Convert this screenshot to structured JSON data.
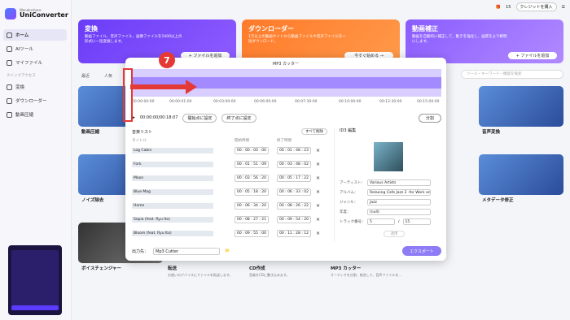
{
  "app": {
    "brand_small": "Wondershare",
    "brand_big": "UniConverter",
    "credits": "15",
    "buy_credits": "クレジットを購入"
  },
  "sidebar": {
    "items": [
      {
        "label": "ホーム"
      },
      {
        "label": "AIツール"
      },
      {
        "label": "マイファイル"
      },
      {
        "label": "変換"
      },
      {
        "label": "ダウンローダー"
      },
      {
        "label": "動画圧縮"
      }
    ],
    "section": "クイックアクセス"
  },
  "cards": [
    {
      "title": "変換",
      "desc": "動画ファイル、音声ファイル、画像ファイルを1000以上の形式に一括変換します。",
      "button": "+ ファイルを追加"
    },
    {
      "title": "ダウンローダー",
      "desc": "1万以上の動画サイトから動画ファイルや音声ファイルを一括ダウンロード。",
      "button": "今すぐ始める →"
    },
    {
      "title": "動画補正",
      "desc": "動画を自動的に補正して、動きを強化し、画質をより鮮明にします。",
      "button": "+ ファイルを追加"
    }
  ],
  "tiles": {
    "t1_label": "動画圧縮",
    "t2_label": "ノイズ除去",
    "t3_label": "ボイスチェンジャー",
    "t4_label": "音声変換",
    "t5_label": "メタデータ修正",
    "b1": "転送",
    "b2": "CD作成",
    "b3": "MP3 カッター",
    "d1": "お使いのデバイスにファイルを転送します。",
    "d2": "音楽をCDに書き込みます。",
    "d3": "オーディオを分割、結合して、音声ファイルを…"
  },
  "tabs": {
    "recent": "最近",
    "hot": "人気"
  },
  "search": {
    "placeholder": "ツール・キーワード・機能を検索"
  },
  "modal": {
    "title": "MP3 カッター",
    "timeline": [
      "00:00:00:00",
      "00:00:01:00",
      "00:03:00:00",
      "00:06:00:00",
      "00:07:30:00",
      "00:10:00:00",
      "00:12:30:00",
      "00:15:00:00"
    ],
    "time_display": "00:00:00/00:18:07",
    "btn_set_start": "開始点に設定",
    "btn_set_end": "終了点に設定",
    "btn_split": "分割",
    "list_title": "音楽リスト",
    "clear_all": "すべて削除",
    "col_title": "タイトル",
    "col_start": "開始時間",
    "col_end": "終了時間",
    "rows": [
      {
        "name": "Log Cabin",
        "start": "00 : 00 : 00 : 00",
        "end": "00 : 01 : 48 : 23"
      },
      {
        "name": "Fork",
        "start": "00 : 01 : 51 : 09",
        "end": "00 : 03 : 48 : 02"
      },
      {
        "name": "Moon",
        "start": "00 : 03 : 56 : 20",
        "end": "00 : 05 : 17 : 22"
      },
      {
        "name": "Blue Mag",
        "start": "00 : 05 : 18 : 20",
        "end": "00 : 06 : 33 : 02"
      },
      {
        "name": "Home",
        "start": "00 : 06 : 34 : 20",
        "end": "00 : 08 : 26 : 22"
      },
      {
        "name": "Sepia (feat. Ryu Ito)",
        "start": "00 : 08 : 27 : 21",
        "end": "00 : 09 : 54 : 20"
      },
      {
        "name": "Bloom (feat. Ryu Ito)",
        "start": "00 : 09 : 55 : 00",
        "end": "00 : 11 : 28 : 12"
      }
    ],
    "id3_title": "ID3 編集",
    "artist_label": "アーティスト：",
    "artist_value": "Various Artists",
    "album_label": "アルバム：",
    "album_value": "Relaxing Cafe Jazz 2 -for Work and S",
    "genre_label": "ジャンル：",
    "genre_value": "Jazz",
    "year_label": "年度：",
    "year_value": "(null)",
    "track_label": "トラック番号：",
    "track_value": "5",
    "track_total": "15",
    "apply": "適用",
    "output_label": "出力先：",
    "output_value": "Mp3 Cutter",
    "export": "エクスポート"
  },
  "callout": "7"
}
